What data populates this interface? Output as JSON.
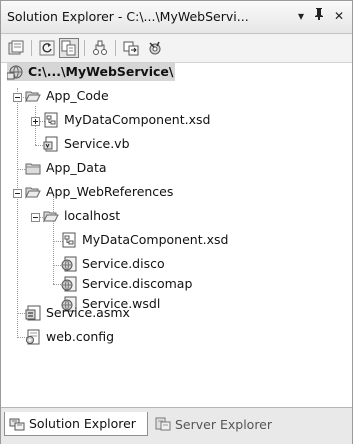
{
  "window": {
    "title": "Solution Explorer - C:\\...\\MyWebServi...",
    "dropdown_glyph": "▾",
    "pin_glyph": "ᵮ",
    "close_glyph": "✕"
  },
  "toolbar": {
    "buttons": [
      {
        "name": "properties-icon"
      },
      {
        "name": "refresh-icon"
      },
      {
        "name": "show-all-files-icon"
      },
      {
        "name": "nest-related-files-icon"
      },
      {
        "name": "copy-web-site-icon"
      },
      {
        "name": "asp-net-configuration-icon"
      }
    ]
  },
  "tree": {
    "root": "C:\\...\\MyWebService\\",
    "app_code": "App_Code",
    "mydatacomponent_1": "MyDataComponent.xsd",
    "service_vb": "Service.vb",
    "app_data": "App_Data",
    "app_webreferences": "App_WebReferences",
    "localhost": "localhost",
    "mydatacomponent_2": "MyDataComponent.xsd",
    "service_disco": "Service.disco",
    "service_discomap": "Service.discomap",
    "service_wsdl": "Service.wsdl",
    "service_asmx": "Service.asmx",
    "web_config": "web.config"
  },
  "tabs": {
    "solution_explorer": "Solution Explorer",
    "server_explorer": "Server Explorer"
  }
}
